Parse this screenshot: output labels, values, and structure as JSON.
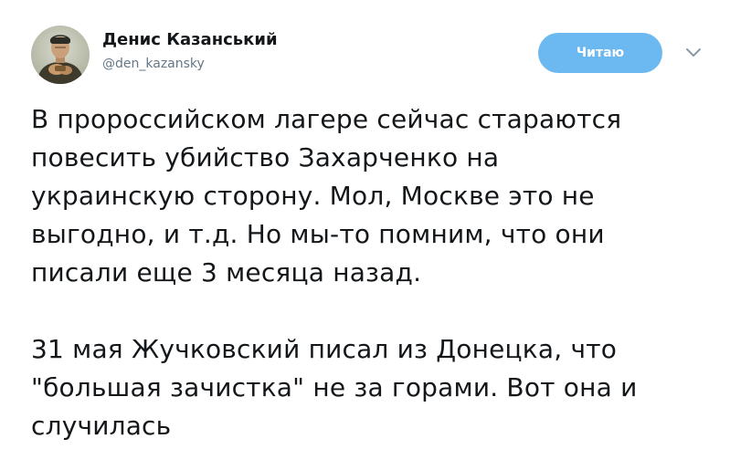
{
  "author": {
    "display_name": "Денис Казанський",
    "handle": "@den_kazansky"
  },
  "follow_button": {
    "label": "Читаю"
  },
  "tweet": {
    "paragraphs": [
      {
        "lines": [
          "В пророссийском лагере сейчас стараются",
          "повесить убийство Захарченко на",
          "украинскую сторону. Мол, Москве это не",
          "выгодно, и т.д. Но мы-то помним, что они",
          "писали еще 3 месяца назад."
        ]
      },
      {
        "lines": [
          "31 мая Жучковский  писал из Донецка, что",
          "\"большая зачистка\" не за горами. Вот она и",
          "случилась"
        ]
      }
    ]
  },
  "colors": {
    "follow_button_bg": "#6cb9f1",
    "text": "#14171a",
    "secondary_text": "#657786"
  },
  "icons": {
    "avatar": "avatar-photo",
    "caret": "chevron-down-icon"
  }
}
